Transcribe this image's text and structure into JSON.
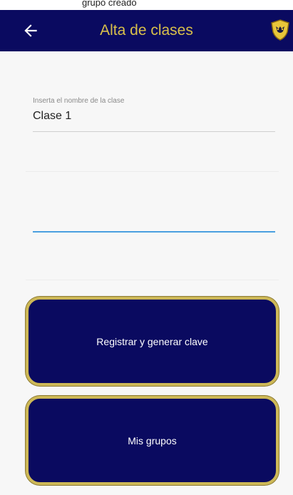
{
  "status_bar": {
    "text": "grupo creado"
  },
  "appbar": {
    "title": "Alta de clases",
    "back_icon": "arrow-left-icon",
    "logo_icon": "shield-icon",
    "background_color": "#0a0a60",
    "title_color": "#d9c04a"
  },
  "form": {
    "class_name_label": "Inserta el nombre de la clase",
    "class_name_value": "Clase 1"
  },
  "buttons": {
    "register_label": "Registrar y generar clave",
    "groups_label": "Mis grupos",
    "border_color": "#cdb857"
  }
}
